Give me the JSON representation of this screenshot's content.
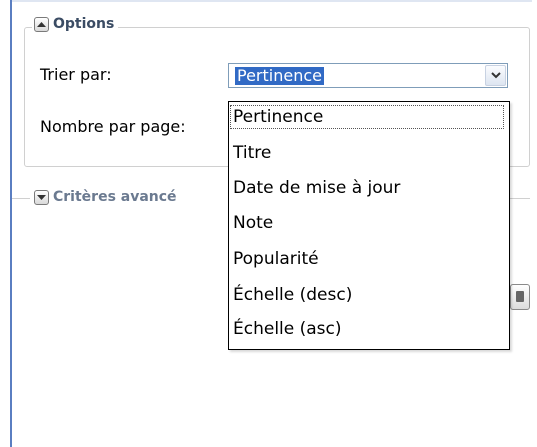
{
  "options": {
    "legend": "Options",
    "sort_label": "Trier par:",
    "per_page_label": "Nombre par page:",
    "sort_selected": "Pertinence",
    "sort_options": [
      "Pertinence",
      "Titre",
      "Date de mise à jour",
      "Note",
      "Popularité",
      "Échelle (desc)",
      "Échelle (asc)"
    ]
  },
  "criteria": {
    "legend": "Critères avancé"
  },
  "icons": {
    "options_toggle": "collapse-up-icon",
    "criteria_toggle": "expand-down-icon",
    "select_arrow": "chevron-down-icon"
  },
  "colors": {
    "accent_rule": "#5a7ec1",
    "selection": "#316ac5",
    "legend_text": "#3b4c64"
  }
}
